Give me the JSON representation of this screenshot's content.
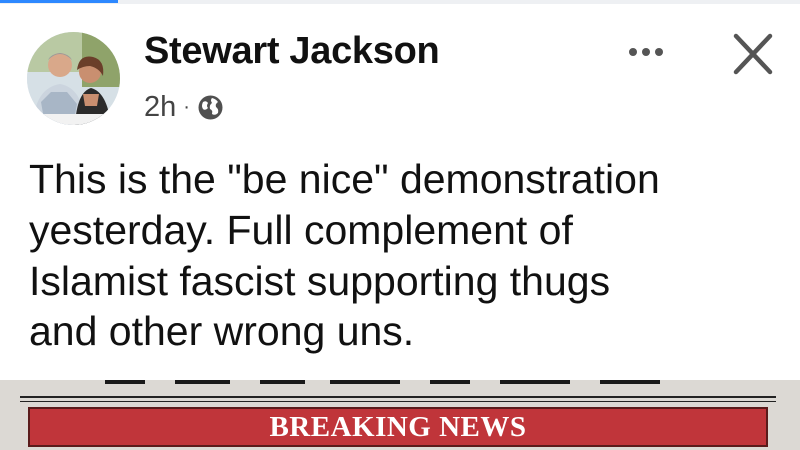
{
  "post": {
    "author": "Stewart Jackson",
    "time": "2h",
    "separator": "·",
    "privacy_icon": "globe-icon",
    "more_icon": "more-icon",
    "close_icon": "close-icon",
    "text": "This is the \"be nice\" demonstration\nyesterday. Full complement of\nIslamist fascist supporting thugs\nand other wrong uns."
  },
  "image": {
    "banner_text": "BREAKING NEWS",
    "banner_color": "#c0353a"
  },
  "colors": {
    "accent": "#2d88ff",
    "text": "#111111",
    "secondary_text": "#444444"
  }
}
